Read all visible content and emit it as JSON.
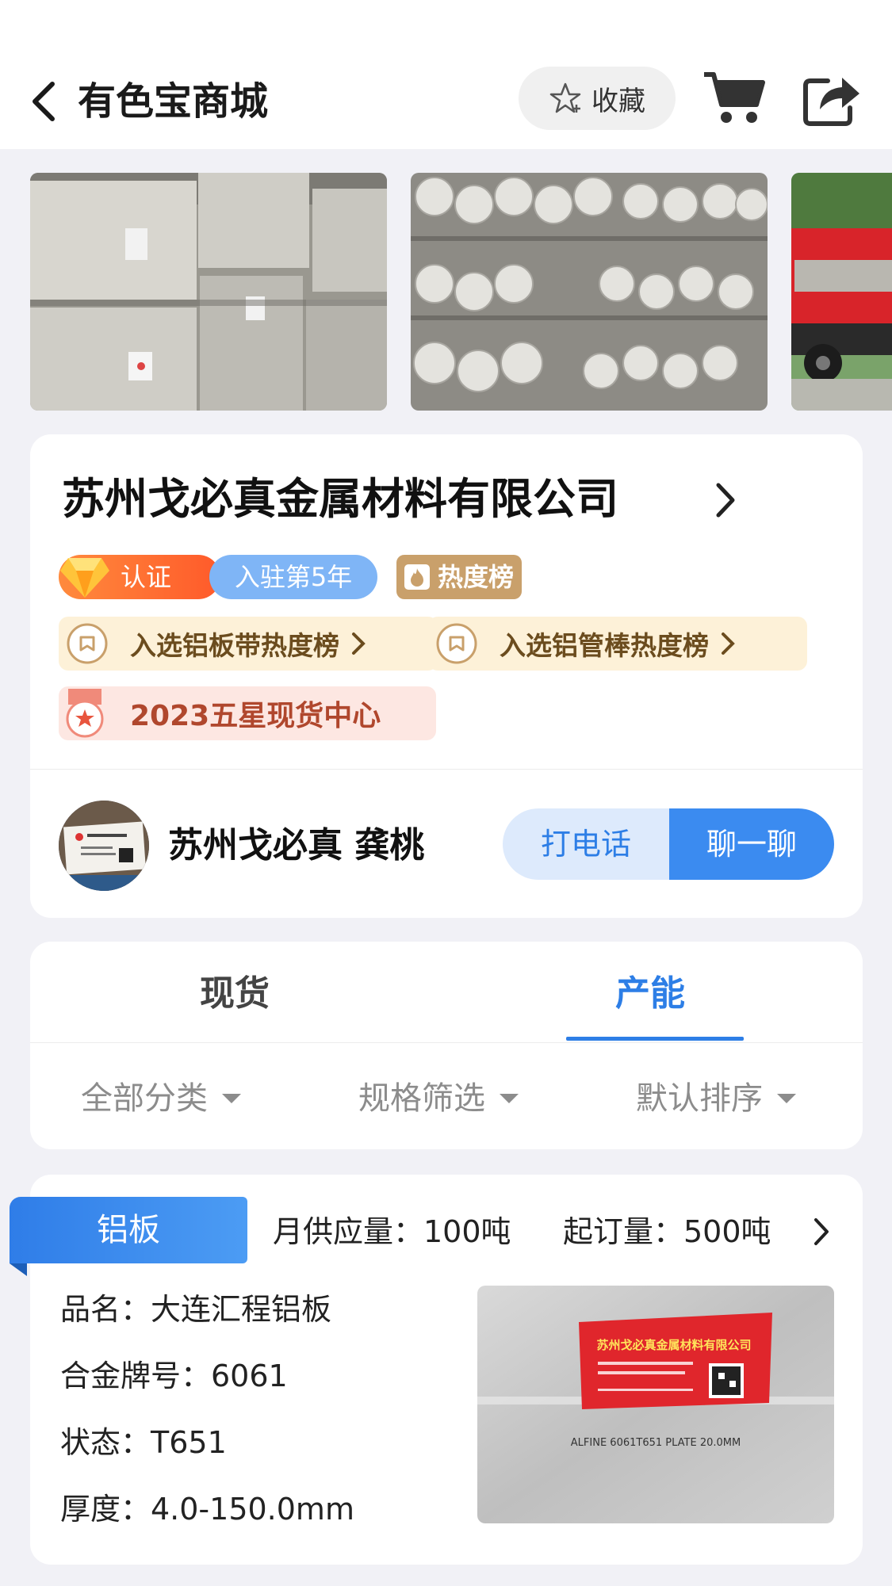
{
  "header": {
    "title": "有色宝商城",
    "favorite_label": "收藏"
  },
  "company": {
    "name": "苏州戈必真金属材料有限公司",
    "tags": {
      "certified": "认证",
      "years": "入驻第5年",
      "hot": "热度榜"
    },
    "rankings": [
      "入选铝板带热度榜",
      "入选铝管棒热度榜"
    ],
    "star_center": "2023五星现货中心",
    "contact": {
      "name": "苏州戈必真 龚桃",
      "call_label": "打电话",
      "chat_label": "聊一聊"
    }
  },
  "tabs": {
    "items": [
      "现货",
      "产能"
    ],
    "active": "产能"
  },
  "filters": [
    "全部分类",
    "规格筛选",
    "默认排序"
  ],
  "product": {
    "category": "铝板",
    "monthly_supply": "月供应量：100吨",
    "min_order": "起订量：500吨",
    "specs": {
      "name": "品名：大连汇程铝板",
      "alloy": "合金牌号：6061",
      "temper": "状态：T651",
      "thickness": "厚度：4.0-150.0mm"
    },
    "photo_sign": {
      "company": "苏州戈必真金属材料有限公司",
      "plate_text": "ALFINE 6061T651 PLATE 20.0MM"
    }
  },
  "colors": {
    "accent_blue": "#2d7ee6",
    "cert_orange": "#ff6a30",
    "hot_gold": "#c9a06b"
  }
}
